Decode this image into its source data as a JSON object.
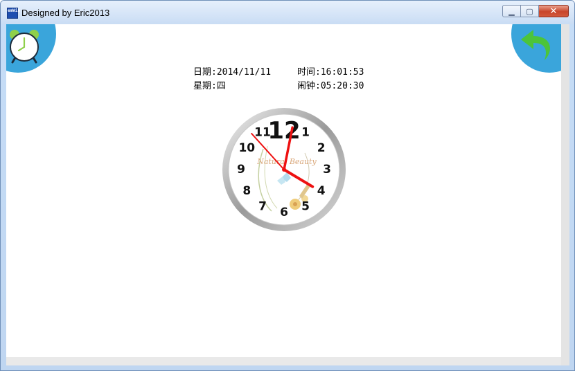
{
  "window": {
    "title": "Designed by Eric2013",
    "icon_label": "emWin",
    "controls": {
      "minimize": "▁",
      "maximize": "▢",
      "close": "✕"
    }
  },
  "info": {
    "date_label": "日期:",
    "date_value": "2014/11/11",
    "time_label": "时间:",
    "time_value": "16:01:53",
    "weekday_label": "星期:",
    "weekday_value": "四",
    "alarm_label": "闹钟:",
    "alarm_value": "05:20:30"
  },
  "clock": {
    "numbers": [
      "12",
      "1",
      "2",
      "3",
      "4",
      "5",
      "6",
      "7",
      "8",
      "9",
      "10",
      "11"
    ],
    "watermark": "Natural Beauty",
    "hour": 16,
    "minute": 1,
    "second": 53,
    "hand_color": "#ee1111"
  },
  "colors": {
    "accent": "#3aa5db",
    "back_arrow": "#4cc43a"
  },
  "icons": {
    "alarm": "alarm-clock-icon",
    "back": "back-arrow-icon"
  }
}
